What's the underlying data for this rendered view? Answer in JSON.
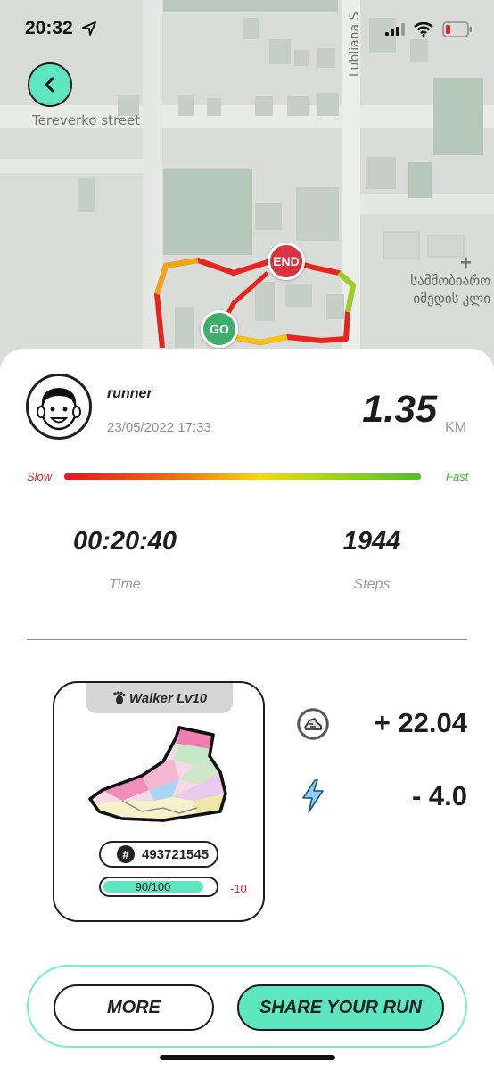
{
  "status_bar": {
    "time": "20:32",
    "icons": [
      "location-arrow-icon",
      "cellular-signal-icon",
      "wifi-icon",
      "battery-low-icon"
    ]
  },
  "map": {
    "streets": [
      "Tereverko street",
      "Lubliana S"
    ],
    "poi_label": "სამშობიარო იმედის კლი",
    "markers": {
      "start": "GO",
      "end": "END"
    }
  },
  "run": {
    "username": "runner",
    "date": "23/05/2022 17:33",
    "distance": "1.35",
    "distance_unit": "KM",
    "speed_scale": {
      "slow": "Slow",
      "fast": "Fast"
    },
    "time": {
      "value": "00:20:40",
      "label": "Time"
    },
    "steps": {
      "value": "1944",
      "label": "Steps"
    }
  },
  "sneaker": {
    "level": "Walker Lv10",
    "token_id": "493721545",
    "durability_text": "90/100",
    "durability_fraction": 0.9,
    "durability_delta": "-10"
  },
  "earnings": {
    "gst": "+ 22.04",
    "energy": "- 4.0"
  },
  "actions": {
    "more": "MORE",
    "share": "SHARE YOUR RUN"
  },
  "colors": {
    "accent": "#5ee6c1",
    "end_marker": "#d9343f",
    "go_marker": "#3fae6c",
    "slow": "#e2242a",
    "fast": "#45b52a"
  }
}
